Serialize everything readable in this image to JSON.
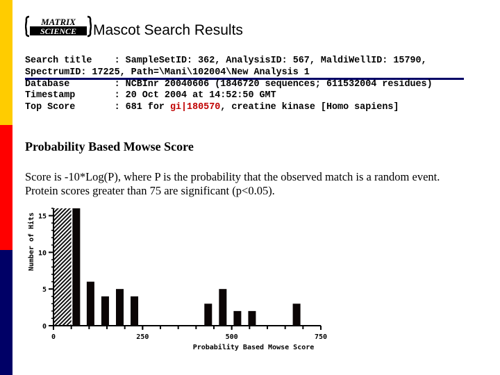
{
  "colors": {
    "side_yellow": "#ffcc00",
    "side_red": "#ff0000",
    "side_navy": "#000066",
    "rule": "#000066",
    "link_red": "#c00000",
    "bar": "#0b0505"
  },
  "header": {
    "logo_line1": "MATRIX",
    "logo_line2": "SCIENCE",
    "title": "Mascot Search Results"
  },
  "info": {
    "search_title_label": "Search title    : ",
    "search_title_value": "SampleSetID: 362, AnalysisID: 567, MaldiWellID: 15790, SpectrumID: 17225, Path=\\Mani\\102004\\New Analysis 1",
    "database_label": "Database        : ",
    "database_value": "NCBInr 20040606 (1846720 sequences; 611532004 residues)",
    "timestamp_label": "Timestamp       : ",
    "timestamp_value": "20 Oct 2004 at 14:52:50 GMT",
    "top_score_label": "Top Score       : ",
    "top_score_prefix": "681 for ",
    "top_score_link": "gi|180570",
    "top_score_suffix": ", creatine kinase [Homo sapiens]"
  },
  "section": {
    "heading": "Probability Based Mowse Score",
    "description": "Score is -10*Log(P), where P is the probability that the observed match is a random event. Protein scores greater than 75 are significant (p<0.05)."
  },
  "chart_data": {
    "type": "bar",
    "title": "",
    "xlabel": "Probability Based Mowse Score",
    "ylabel": "Number of Hits",
    "xlim": [
      0,
      750
    ],
    "ylim": [
      0,
      16
    ],
    "x_ticks": [
      0,
      250,
      500,
      750
    ],
    "x_tick_labels": [
      "0",
      "250",
      "500",
      "750"
    ],
    "x_minor_step": 50,
    "y_ticks": [
      0,
      5,
      10,
      15
    ],
    "y_tick_labels": [
      "0",
      "5",
      "10",
      "15"
    ],
    "y_minor_step": 1,
    "shaded_region": {
      "from": 0,
      "to": 50,
      "pattern": "hatched",
      "meaning": "non-significant scores"
    },
    "bins": [
      {
        "score": 64,
        "hits": 16
      },
      {
        "score": 104,
        "hits": 6
      },
      {
        "score": 145,
        "hits": 4
      },
      {
        "score": 186,
        "hits": 5
      },
      {
        "score": 227,
        "hits": 4
      },
      {
        "score": 434,
        "hits": 3
      },
      {
        "score": 475,
        "hits": 5
      },
      {
        "score": 516,
        "hits": 2
      },
      {
        "score": 557,
        "hits": 2
      },
      {
        "score": 682,
        "hits": 3
      }
    ],
    "grid": false,
    "legend": "none"
  }
}
